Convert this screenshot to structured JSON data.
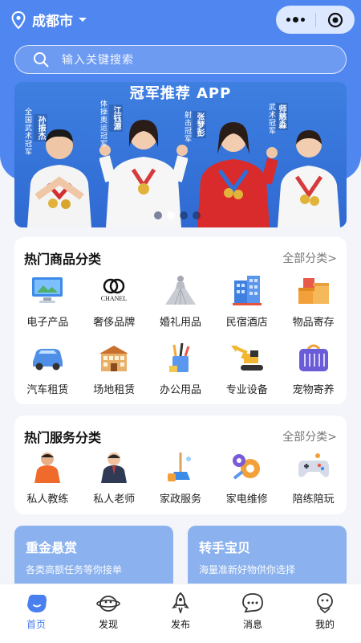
{
  "location": {
    "city": "成都市"
  },
  "search": {
    "placeholder": "输入关键搜索"
  },
  "banner": {
    "title": "冠军推荐 APP",
    "people": [
      {
        "name": "孙振杰",
        "caption": "全国武术冠军"
      },
      {
        "name": "江钰源",
        "caption": "体操奥运冠军"
      },
      {
        "name": "张梦彭",
        "caption": "射击冠军"
      },
      {
        "name": "师慈淼",
        "caption": "武术冠军"
      }
    ],
    "slide_count": 4,
    "active_slide": 2
  },
  "goods": {
    "title": "热门商品分类",
    "more": "全部分类>",
    "items": [
      {
        "label": "电子产品",
        "icon": "monitor-icon"
      },
      {
        "label": "奢侈品牌",
        "icon": "chanel-logo-icon",
        "logo_text": "CHANEL"
      },
      {
        "label": "婚礼用品",
        "icon": "wedding-dress-icon"
      },
      {
        "label": "民宿酒店",
        "icon": "hotel-building-icon"
      },
      {
        "label": "物品寄存",
        "icon": "storage-boxes-icon"
      },
      {
        "label": "汽车租赁",
        "icon": "car-icon"
      },
      {
        "label": "场地租赁",
        "icon": "venue-building-icon"
      },
      {
        "label": "办公用品",
        "icon": "office-supplies-icon"
      },
      {
        "label": "专业设备",
        "icon": "excavator-icon"
      },
      {
        "label": "宠物寄养",
        "icon": "pet-carrier-icon"
      }
    ]
  },
  "services": {
    "title": "热门服务分类",
    "more": "全部分类>",
    "items": [
      {
        "label": "私人教练",
        "icon": "coach-person-icon"
      },
      {
        "label": "私人老师",
        "icon": "teacher-person-icon"
      },
      {
        "label": "家政服务",
        "icon": "cleaning-mop-icon"
      },
      {
        "label": "家电维修",
        "icon": "repair-gear-icon"
      },
      {
        "label": "陪练陪玩",
        "icon": "gamepad-icon"
      }
    ]
  },
  "promos": [
    {
      "title": "重金悬赏",
      "subtitle": "各类高额任务等你接单"
    },
    {
      "title": "转手宝贝",
      "subtitle": "海量准新好物供你选择"
    }
  ],
  "tabs": [
    {
      "label": "首页",
      "icon": "home-icon",
      "active": true
    },
    {
      "label": "发现",
      "icon": "discover-icon",
      "active": false
    },
    {
      "label": "发布",
      "icon": "rocket-icon",
      "active": false
    },
    {
      "label": "消息",
      "icon": "message-icon",
      "active": false
    },
    {
      "label": "我的",
      "icon": "profile-icon",
      "active": false
    }
  ],
  "colors": {
    "primary": "#4f86f0",
    "promo": "#8bb2ee",
    "active_tab": "#4a7ff0"
  }
}
